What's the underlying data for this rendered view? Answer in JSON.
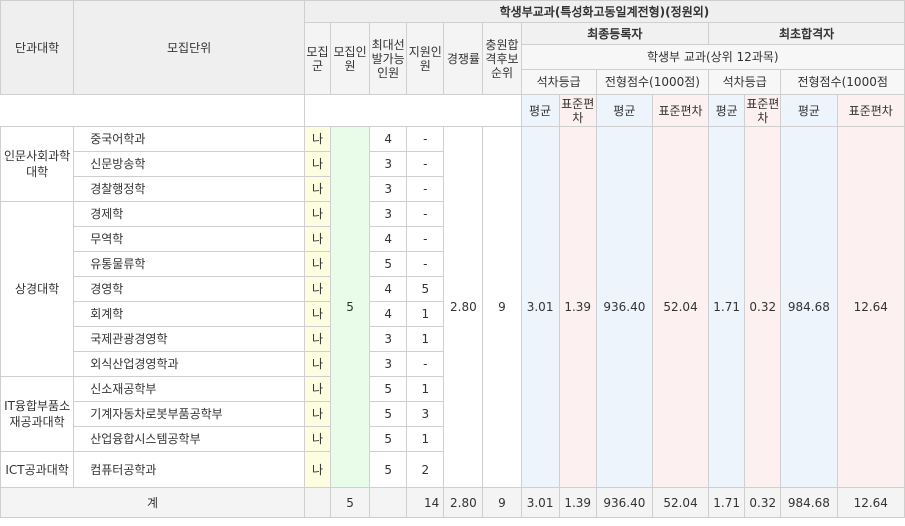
{
  "header": {
    "college": "단과대학",
    "unit": "모집단위",
    "section_title": "학생부교과(특성화고동일계전형)(정원외)",
    "gun": "모집군",
    "mojip": "모집인원",
    "max_select": "최대선발가능인원",
    "applicants": "지원인원",
    "competition": "경쟁률",
    "waitlist": "충원합격후보순위",
    "final_registered": "최종등록자",
    "first_passed": "최초합격자",
    "criteria": "학생부 교과(상위 12과목)",
    "grade_label": "석차등급",
    "score_label1": "전형점수(1000점)",
    "score_label2": "전형점수(1000점",
    "avg": "평균",
    "sd": "표준편차"
  },
  "rows": [
    {
      "unit": "중국어학과",
      "gun": "나",
      "max": "4",
      "apply": "-"
    },
    {
      "unit": "신문방송학",
      "gun": "나",
      "max": "3",
      "apply": "-"
    },
    {
      "unit": "경찰행정학",
      "gun": "나",
      "max": "3",
      "apply": "-"
    },
    {
      "unit": "경제학",
      "gun": "나",
      "max": "3",
      "apply": "-"
    },
    {
      "unit": "무역학",
      "gun": "나",
      "max": "4",
      "apply": "-"
    },
    {
      "unit": "유통물류학",
      "gun": "나",
      "max": "5",
      "apply": "-"
    },
    {
      "unit": "경영학",
      "gun": "나",
      "max": "4",
      "apply": "5"
    },
    {
      "unit": "회계학",
      "gun": "나",
      "max": "4",
      "apply": "1"
    },
    {
      "unit": "국제관광경영학",
      "gun": "나",
      "max": "3",
      "apply": "1"
    },
    {
      "unit": "외식산업경영학과",
      "gun": "나",
      "max": "3",
      "apply": "-"
    },
    {
      "unit": "신소재공학부",
      "gun": "나",
      "max": "5",
      "apply": "1"
    },
    {
      "unit": "기계자동차로봇부품공학부",
      "gun": "나",
      "max": "5",
      "apply": "3"
    },
    {
      "unit": "산업융합시스템공학부",
      "gun": "나",
      "max": "5",
      "apply": "1"
    },
    {
      "unit": "컴퓨터공학과",
      "gun": "나",
      "max": "5",
      "apply": "2"
    }
  ],
  "colleges": {
    "c1": "인문사회과학대학",
    "c2": "상경대학",
    "c3": "IT융합부품소재공과대학",
    "c4": "ICT공과대학"
  },
  "merged": {
    "mojip": "5",
    "competition": "2.80",
    "waitlist": "9",
    "reg_grade_avg": "3.01",
    "reg_grade_sd": "1.39",
    "reg_score_avg": "936.40",
    "reg_score_sd": "52.04",
    "first_grade_avg": "1.71",
    "first_grade_sd": "0.32",
    "first_score_avg": "984.68",
    "first_score_sd": "12.64"
  },
  "total": {
    "label": "계",
    "mojip": "5",
    "apply": "14",
    "competition": "2.80",
    "waitlist": "9",
    "reg_grade_avg": "3.01",
    "reg_grade_sd": "1.39",
    "reg_score_avg": "936.40",
    "reg_score_sd": "52.04",
    "first_grade_avg": "1.71",
    "first_grade_sd": "0.32",
    "first_score_avg": "984.68",
    "first_score_sd": "12.64"
  }
}
